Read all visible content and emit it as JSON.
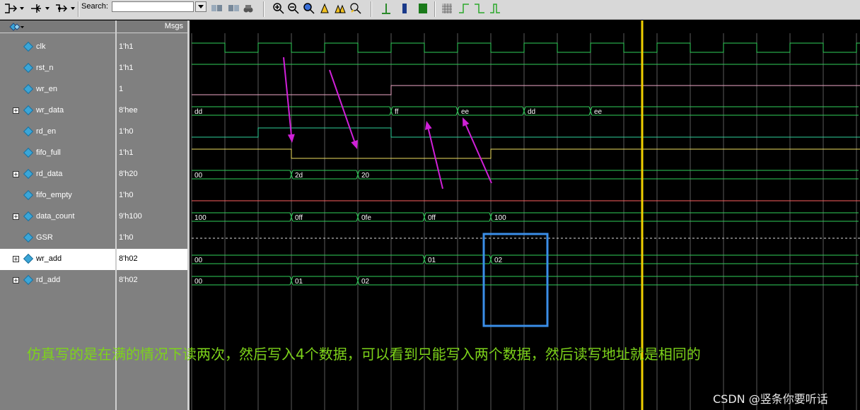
{
  "toolbar": {
    "search_label": "Search:",
    "search_value": ""
  },
  "names_header": {
    "icon": "wave-diamond-icon"
  },
  "values_header": {
    "label": "Msgs"
  },
  "signals": [
    {
      "name": "clk",
      "value": "1'h1",
      "expandable": false
    },
    {
      "name": "rst_n",
      "value": "1'h1",
      "expandable": false
    },
    {
      "name": "wr_en",
      "value": "1",
      "expandable": false
    },
    {
      "name": "wr_data",
      "value": "8'hee",
      "expandable": true
    },
    {
      "name": "rd_en",
      "value": "1'h0",
      "expandable": false
    },
    {
      "name": "fifo_full",
      "value": "1'h1",
      "expandable": false
    },
    {
      "name": "rd_data",
      "value": "8'h20",
      "expandable": true
    },
    {
      "name": "fifo_empty",
      "value": "1'h0",
      "expandable": false
    },
    {
      "name": "data_count",
      "value": "9'h100",
      "expandable": true
    },
    {
      "name": "GSR",
      "value": "1'h0",
      "expandable": false
    },
    {
      "name": "wr_add",
      "value": "8'h02",
      "expandable": true,
      "selected": true
    },
    {
      "name": "rd_add",
      "value": "8'h02",
      "expandable": true
    }
  ],
  "bus_values": {
    "wr_data": [
      "dd",
      "ff",
      "ee",
      "dd",
      "ee"
    ],
    "rd_data": [
      "00",
      "2d",
      "20"
    ],
    "data_count": [
      "100",
      "0ff",
      "0fe",
      "0ff",
      "100"
    ],
    "wr_add": [
      "00",
      "01",
      "02"
    ],
    "rd_add": [
      "00",
      "01",
      "02"
    ]
  },
  "colors": {
    "clk": "#2fd05a",
    "wr_en": "#f0a8c8",
    "rd_en": "#2fd09a",
    "fifo_full": "#f0e060",
    "fifo_empty": "#ff6060",
    "bus": "#2fd05a",
    "cursor": "#f0d000",
    "arrow": "#d020d8",
    "highlight_box": "#3a8ee8",
    "caption": "#7dd31a"
  },
  "caption": "仿真写的是在满的情况下读两次，然后写入4个数据，可以看到只能写入两个数据，然后读写地址就是相同的",
  "watermark": "CSDN @竖条你要听话"
}
